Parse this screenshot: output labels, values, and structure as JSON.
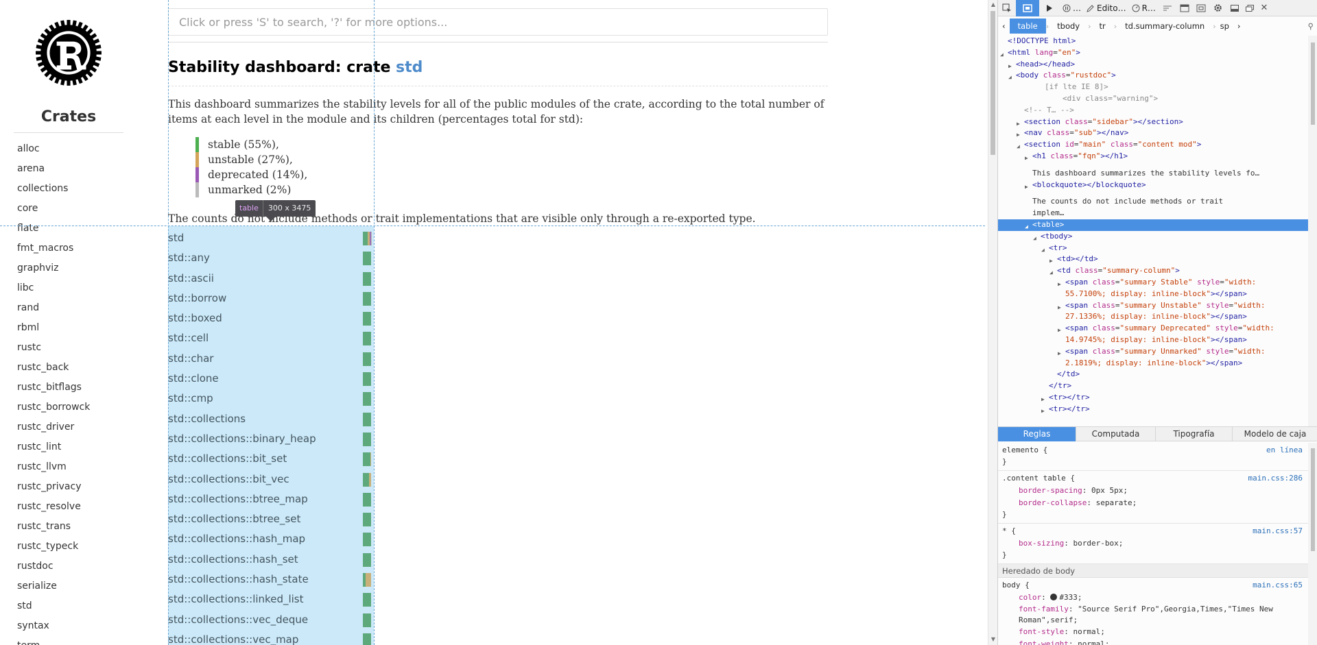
{
  "sidebar": {
    "title": "Crates",
    "crates": [
      "alloc",
      "arena",
      "collections",
      "core",
      "flate",
      "fmt_macros",
      "graphviz",
      "libc",
      "rand",
      "rbml",
      "rustc",
      "rustc_back",
      "rustc_bitflags",
      "rustc_borrowck",
      "rustc_driver",
      "rustc_lint",
      "rustc_llvm",
      "rustc_privacy",
      "rustc_resolve",
      "rustc_trans",
      "rustc_typeck",
      "rustdoc",
      "serialize",
      "std",
      "syntax",
      "term"
    ]
  },
  "search": {
    "placeholder": "Click or press 'S' to search, '?' for more options..."
  },
  "heading": {
    "prefix": "Stability dashboard: crate ",
    "crate": "std"
  },
  "intro": "This dashboard summarizes the stability levels for all of the public modules of the crate, according to the total number of items at each level in the module and its children (percentages total for std):",
  "legend": [
    {
      "label": "stable (55%),",
      "color": "#4caf50"
    },
    {
      "label": "unstable (27%),",
      "color": "#d4a45a"
    },
    {
      "label": "deprecated (14%),",
      "color": "#9b59b6"
    },
    {
      "label": "unmarked (2%)",
      "color": "#bbbbbb"
    }
  ],
  "note": "The counts do not include methods or trait implementations that are visible only through a re-exported type.",
  "tooltip": {
    "tag": "table",
    "dims": "300 x 3475"
  },
  "modules": [
    {
      "name": "std",
      "stable": 0.557,
      "unstable": 0.273,
      "deprecated": 0.15,
      "unmarked": 0.02
    },
    {
      "name": "std::any",
      "stable": 1.0,
      "unstable": 0,
      "deprecated": 0,
      "unmarked": 0
    },
    {
      "name": "std::ascii",
      "stable": 1.0,
      "unstable": 0,
      "deprecated": 0,
      "unmarked": 0
    },
    {
      "name": "std::borrow",
      "stable": 1.0,
      "unstable": 0,
      "deprecated": 0,
      "unmarked": 0
    },
    {
      "name": "std::boxed",
      "stable": 1.0,
      "unstable": 0,
      "deprecated": 0,
      "unmarked": 0
    },
    {
      "name": "std::cell",
      "stable": 1.0,
      "unstable": 0,
      "deprecated": 0,
      "unmarked": 0
    },
    {
      "name": "std::char",
      "stable": 1.0,
      "unstable": 0,
      "deprecated": 0,
      "unmarked": 0
    },
    {
      "name": "std::clone",
      "stable": 1.0,
      "unstable": 0,
      "deprecated": 0,
      "unmarked": 0
    },
    {
      "name": "std::cmp",
      "stable": 1.0,
      "unstable": 0,
      "deprecated": 0,
      "unmarked": 0
    },
    {
      "name": "std::collections",
      "stable": 1.0,
      "unstable": 0,
      "deprecated": 0,
      "unmarked": 0
    },
    {
      "name": "std::collections::binary_heap",
      "stable": 1.0,
      "unstable": 0,
      "deprecated": 0,
      "unmarked": 0
    },
    {
      "name": "std::collections::bit_set",
      "stable": 0.9,
      "unstable": 0.1,
      "deprecated": 0,
      "unmarked": 0
    },
    {
      "name": "std::collections::bit_vec",
      "stable": 0.75,
      "unstable": 0.25,
      "deprecated": 0,
      "unmarked": 0
    },
    {
      "name": "std::collections::btree_map",
      "stable": 1.0,
      "unstable": 0,
      "deprecated": 0,
      "unmarked": 0
    },
    {
      "name": "std::collections::btree_set",
      "stable": 1.0,
      "unstable": 0,
      "deprecated": 0,
      "unmarked": 0
    },
    {
      "name": "std::collections::hash_map",
      "stable": 1.0,
      "unstable": 0,
      "deprecated": 0,
      "unmarked": 0
    },
    {
      "name": "std::collections::hash_set",
      "stable": 1.0,
      "unstable": 0,
      "deprecated": 0,
      "unmarked": 0
    },
    {
      "name": "std::collections::hash_state",
      "stable": 0.3,
      "unstable": 0.7,
      "deprecated": 0,
      "unmarked": 0
    },
    {
      "name": "std::collections::linked_list",
      "stable": 1.0,
      "unstable": 0,
      "deprecated": 0,
      "unmarked": 0
    },
    {
      "name": "std::collections::vec_deque",
      "stable": 1.0,
      "unstable": 0,
      "deprecated": 0,
      "unmarked": 0
    },
    {
      "name": "std::collections::vec_map",
      "stable": 1.0,
      "unstable": 0,
      "deprecated": 0,
      "unmarked": 0
    }
  ],
  "devtools": {
    "toolbar": [
      "Edito…",
      "R…"
    ],
    "breadcrumbs": [
      "table",
      "tbody",
      "tr",
      "td.summary-column",
      "sp"
    ],
    "markup": {
      "doctype": "<!DOCTYPE html>",
      "html_open": "html",
      "html_lang": "en",
      "head": "<head></head>",
      "body_class": "rustdoc",
      "ie_comment": "[if lte IE 8]>",
      "warning_div": "<div class=\"warning\">",
      "comment_end": "<!--        T…            -->",
      "section_sidebar": "sidebar",
      "nav_sub": "sub",
      "section_main_id": "main",
      "section_main_class": "content mod",
      "h1_class": "fqn",
      "text1": "This dashboard summarizes the stability levels fo…",
      "blockquote": "<blockquote></blockquote>",
      "text2a": "The counts do not include methods or trait",
      "text2b": "implem…",
      "table": "<table>",
      "tbody": "<tbody>",
      "tr": "<tr>",
      "td_empty": "<td></td>",
      "td_class": "summary-column",
      "spans": [
        {
          "cls": "summary Stable",
          "s1": "width:",
          "s2": "55.7100%; display: inline-block"
        },
        {
          "cls": "summary Unstable",
          "s1": "width:",
          "s2": "27.1336%; display: inline-block"
        },
        {
          "cls": "summary Deprecated",
          "s1": "width:",
          "s2": "14.9745%; display: inline-block"
        },
        {
          "cls": "summary Unmarked",
          "s1": "width:",
          "s2": "2.1819%; display: inline-block"
        }
      ],
      "td_close": "</td>",
      "tr_close": "</tr>",
      "tr_empty": "<tr></tr>"
    },
    "tabs": [
      "Reglas",
      "Computada",
      "Tipografía",
      "Modelo de caja"
    ],
    "rules": {
      "element_selector": "elemento {",
      "element_source": "en línea",
      "r1_selector": ".content table {",
      "r1_source": "main.css:286",
      "r1_decls": [
        [
          "border-spacing",
          "0px 5px;"
        ],
        [
          "border-collapse",
          "separate;"
        ]
      ],
      "r2_selector": "* {",
      "r2_source": "main.css:57",
      "r2_decls": [
        [
          "box-sizing",
          "border-box;"
        ]
      ],
      "inherited": "Heredado de body",
      "r3_selector": "body {",
      "r3_source": "main.css:65",
      "r3_color_prop": "color",
      "r3_color_val": "#333;",
      "r3_font_family_prop": "font-family",
      "r3_font_family_val": "\"Source Serif Pro\",Georgia,Times,\"Times New Roman\",serif;",
      "r3_font_style_prop": "font-style",
      "r3_font_style_val": "normal;",
      "r3_font_weight_prop": "font-weight",
      "r3_font_weight_val": "normal;",
      "close_brace": "}"
    }
  }
}
